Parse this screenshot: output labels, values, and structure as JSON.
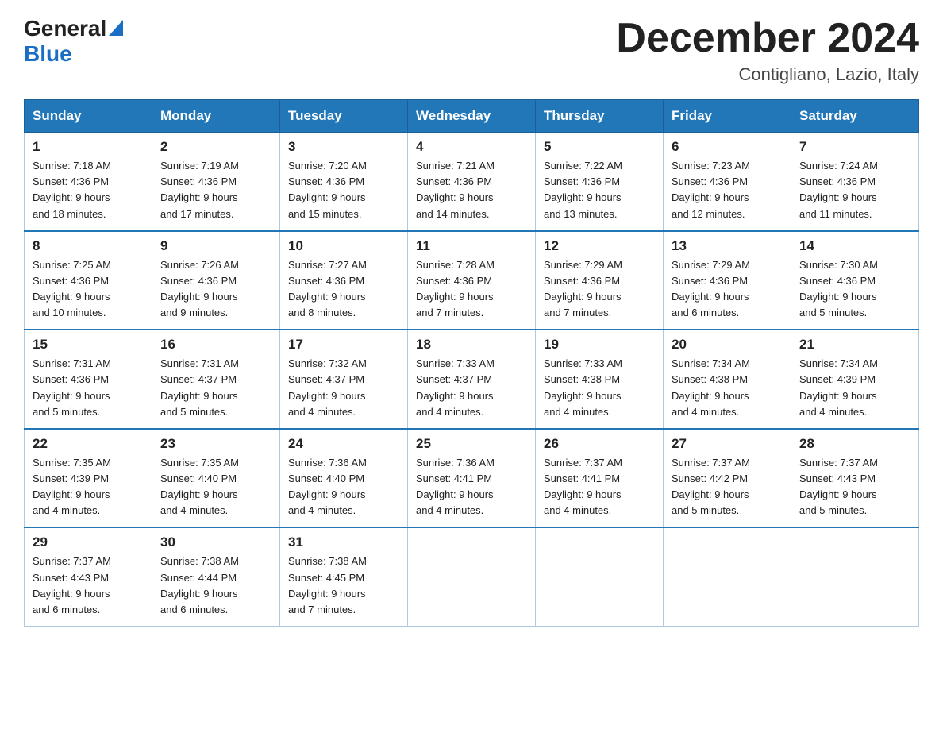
{
  "header": {
    "logo_general": "General",
    "logo_blue": "Blue",
    "title": "December 2024",
    "subtitle": "Contigliano, Lazio, Italy"
  },
  "calendar": {
    "weekdays": [
      "Sunday",
      "Monday",
      "Tuesday",
      "Wednesday",
      "Thursday",
      "Friday",
      "Saturday"
    ],
    "weeks": [
      [
        {
          "day": "1",
          "sunrise": "7:18 AM",
          "sunset": "4:36 PM",
          "daylight": "9 hours and 18 minutes."
        },
        {
          "day": "2",
          "sunrise": "7:19 AM",
          "sunset": "4:36 PM",
          "daylight": "9 hours and 17 minutes."
        },
        {
          "day": "3",
          "sunrise": "7:20 AM",
          "sunset": "4:36 PM",
          "daylight": "9 hours and 15 minutes."
        },
        {
          "day": "4",
          "sunrise": "7:21 AM",
          "sunset": "4:36 PM",
          "daylight": "9 hours and 14 minutes."
        },
        {
          "day": "5",
          "sunrise": "7:22 AM",
          "sunset": "4:36 PM",
          "daylight": "9 hours and 13 minutes."
        },
        {
          "day": "6",
          "sunrise": "7:23 AM",
          "sunset": "4:36 PM",
          "daylight": "9 hours and 12 minutes."
        },
        {
          "day": "7",
          "sunrise": "7:24 AM",
          "sunset": "4:36 PM",
          "daylight": "9 hours and 11 minutes."
        }
      ],
      [
        {
          "day": "8",
          "sunrise": "7:25 AM",
          "sunset": "4:36 PM",
          "daylight": "9 hours and 10 minutes."
        },
        {
          "day": "9",
          "sunrise": "7:26 AM",
          "sunset": "4:36 PM",
          "daylight": "9 hours and 9 minutes."
        },
        {
          "day": "10",
          "sunrise": "7:27 AM",
          "sunset": "4:36 PM",
          "daylight": "9 hours and 8 minutes."
        },
        {
          "day": "11",
          "sunrise": "7:28 AM",
          "sunset": "4:36 PM",
          "daylight": "9 hours and 7 minutes."
        },
        {
          "day": "12",
          "sunrise": "7:29 AM",
          "sunset": "4:36 PM",
          "daylight": "9 hours and 7 minutes."
        },
        {
          "day": "13",
          "sunrise": "7:29 AM",
          "sunset": "4:36 PM",
          "daylight": "9 hours and 6 minutes."
        },
        {
          "day": "14",
          "sunrise": "7:30 AM",
          "sunset": "4:36 PM",
          "daylight": "9 hours and 5 minutes."
        }
      ],
      [
        {
          "day": "15",
          "sunrise": "7:31 AM",
          "sunset": "4:36 PM",
          "daylight": "9 hours and 5 minutes."
        },
        {
          "day": "16",
          "sunrise": "7:31 AM",
          "sunset": "4:37 PM",
          "daylight": "9 hours and 5 minutes."
        },
        {
          "day": "17",
          "sunrise": "7:32 AM",
          "sunset": "4:37 PM",
          "daylight": "9 hours and 4 minutes."
        },
        {
          "day": "18",
          "sunrise": "7:33 AM",
          "sunset": "4:37 PM",
          "daylight": "9 hours and 4 minutes."
        },
        {
          "day": "19",
          "sunrise": "7:33 AM",
          "sunset": "4:38 PM",
          "daylight": "9 hours and 4 minutes."
        },
        {
          "day": "20",
          "sunrise": "7:34 AM",
          "sunset": "4:38 PM",
          "daylight": "9 hours and 4 minutes."
        },
        {
          "day": "21",
          "sunrise": "7:34 AM",
          "sunset": "4:39 PM",
          "daylight": "9 hours and 4 minutes."
        }
      ],
      [
        {
          "day": "22",
          "sunrise": "7:35 AM",
          "sunset": "4:39 PM",
          "daylight": "9 hours and 4 minutes."
        },
        {
          "day": "23",
          "sunrise": "7:35 AM",
          "sunset": "4:40 PM",
          "daylight": "9 hours and 4 minutes."
        },
        {
          "day": "24",
          "sunrise": "7:36 AM",
          "sunset": "4:40 PM",
          "daylight": "9 hours and 4 minutes."
        },
        {
          "day": "25",
          "sunrise": "7:36 AM",
          "sunset": "4:41 PM",
          "daylight": "9 hours and 4 minutes."
        },
        {
          "day": "26",
          "sunrise": "7:37 AM",
          "sunset": "4:41 PM",
          "daylight": "9 hours and 4 minutes."
        },
        {
          "day": "27",
          "sunrise": "7:37 AM",
          "sunset": "4:42 PM",
          "daylight": "9 hours and 5 minutes."
        },
        {
          "day": "28",
          "sunrise": "7:37 AM",
          "sunset": "4:43 PM",
          "daylight": "9 hours and 5 minutes."
        }
      ],
      [
        {
          "day": "29",
          "sunrise": "7:37 AM",
          "sunset": "4:43 PM",
          "daylight": "9 hours and 6 minutes."
        },
        {
          "day": "30",
          "sunrise": "7:38 AM",
          "sunset": "4:44 PM",
          "daylight": "9 hours and 6 minutes."
        },
        {
          "day": "31",
          "sunrise": "7:38 AM",
          "sunset": "4:45 PM",
          "daylight": "9 hours and 7 minutes."
        },
        null,
        null,
        null,
        null
      ]
    ],
    "labels": {
      "sunrise": "Sunrise:",
      "sunset": "Sunset:",
      "daylight": "Daylight:"
    }
  }
}
